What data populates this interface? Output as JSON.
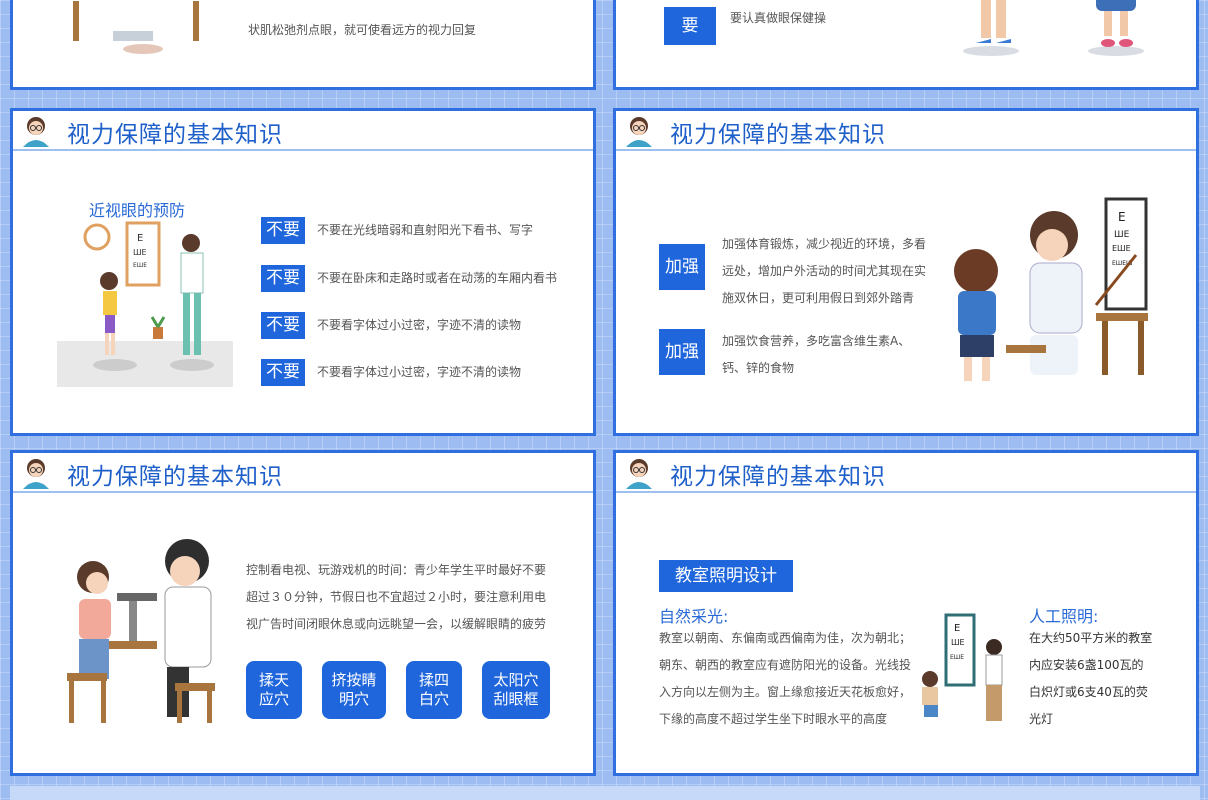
{
  "top_left": {
    "text": "状肌松弛剂点眼，就可使看远方的视力回复"
  },
  "top_right": {
    "tag": "要",
    "text": "要认真做眼保健操"
  },
  "slide_title": "视力保障的基本知识",
  "slide_a": {
    "subtitle": "近视眼的预防",
    "items": [
      {
        "tag": "不要",
        "text": "不要在光线暗弱和直射阳光下看书、写字"
      },
      {
        "tag": "不要",
        "text": "不要在卧床和走路时或者在动荡的车厢内看书"
      },
      {
        "tag": "不要",
        "text": "不要看字体过小过密，字迹不清的读物"
      },
      {
        "tag": "不要",
        "text": "不要看字体过小过密，字迹不清的读物"
      }
    ]
  },
  "slide_b": {
    "items": [
      {
        "tag": "加强",
        "text": "加强体育锻炼，减少视近的环境，多看远处，增加户外活动的时间尤其现在实施双休日，更可利用假日到郊外踏青"
      },
      {
        "tag": "加强",
        "text": "加强饮食营养，多吃富含维生素A、钙、锌的食物"
      }
    ]
  },
  "slide_c": {
    "text": "控制看电视、玩游戏机的时间：青少年学生平时最好不要超过３０分钟，节假日也不宜超过２小时，要注意利用电视广告时间闭眼休息或向远眺望一会，以缓解眼睛的疲劳",
    "buttons": [
      "揉天应穴",
      "挤按睛明穴",
      "揉四白穴",
      "太阳穴刮眼框"
    ]
  },
  "slide_d": {
    "tag": "教室照明设计",
    "left_heading": "自然采光:",
    "left_text": "教室以朝南、东偏南或西偏南为佳，次为朝北；朝东、朝西的教室应有遮防阳光的设备。光线投入方向以左侧为主。窗上缘愈接近天花板愈好，下缘的高度不超过学生坐下时眼水平的高度",
    "right_heading": "人工照明:",
    "right_text": "在大约50平方米的教室内应安装6盏100瓦的白炽灯或6支40瓦的荧光灯"
  }
}
